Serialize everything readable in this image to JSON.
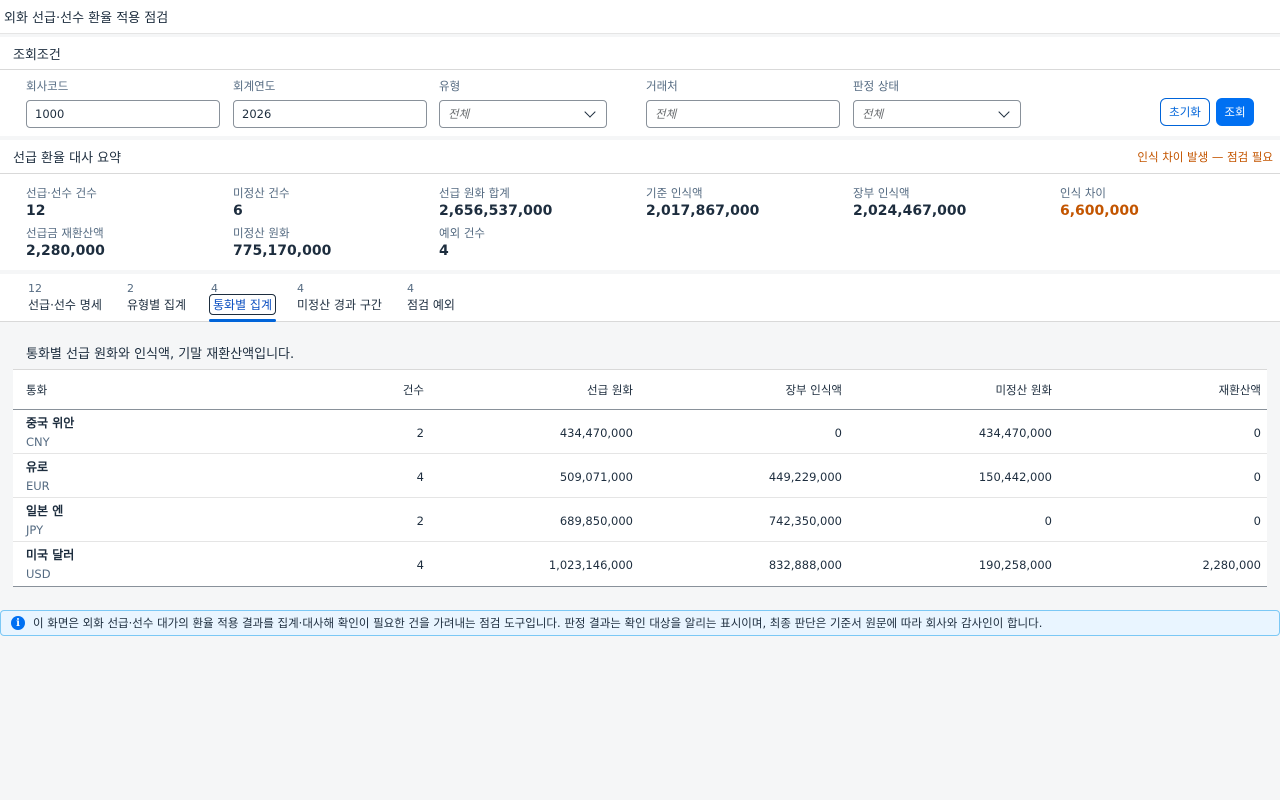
{
  "app": {
    "title": "외화 선급·선수 환율 적용 점검"
  },
  "filters": {
    "section_title": "조회조건",
    "company_code": {
      "label": "회사코드",
      "value": "1000"
    },
    "fiscal_year": {
      "label": "회계연도",
      "value": "2026"
    },
    "type": {
      "label": "유형",
      "value": "전체"
    },
    "partner": {
      "label": "거래처",
      "placeholder": "전체"
    },
    "judgment_status": {
      "label": "판정 상태",
      "value": "전체"
    },
    "reset_label": "초기화",
    "search_label": "조회"
  },
  "summary": {
    "title": "선급 환율 대사 요약",
    "warning": "인식 차이 발생 — 점검 필요",
    "kpis": [
      {
        "label": "선급·선수 건수",
        "value": "12"
      },
      {
        "label": "미정산 건수",
        "value": "6"
      },
      {
        "label": "선급 원화 합계",
        "value": "2,656,537,000"
      },
      {
        "label": "기준 인식액",
        "value": "2,017,867,000"
      },
      {
        "label": "장부 인식액",
        "value": "2,024,467,000"
      },
      {
        "label": "인식 차이",
        "value": "6,600,000"
      },
      {
        "label": "선급금 재환산액",
        "value": "2,280,000"
      },
      {
        "label": "미정산 원화",
        "value": "775,170,000"
      },
      {
        "label": "예외 건수",
        "value": "4"
      }
    ],
    "highlight_color": "#c35500"
  },
  "tabs": [
    {
      "count": "12",
      "label": "선급·선수 명세"
    },
    {
      "count": "2",
      "label": "유형별 집계"
    },
    {
      "count": "4",
      "label": "통화별 집계"
    },
    {
      "count": "4",
      "label": "미정산 경과 구간"
    },
    {
      "count": "4",
      "label": "점검 예외"
    }
  ],
  "content": {
    "description": "통화별 선급 원화와 인식액, 기말 재환산액입니다.",
    "columns": [
      "통화",
      "건수",
      "선급 원화",
      "장부 인식액",
      "미정산 원화",
      "재환산액"
    ],
    "rows": [
      {
        "name": "중국 위안",
        "code": "CNY",
        "count": "2",
        "advance_krw": "434,470,000",
        "book_recognized": "0",
        "unsettled_krw": "434,470,000",
        "revaluation": "0"
      },
      {
        "name": "유로",
        "code": "EUR",
        "count": "4",
        "advance_krw": "509,071,000",
        "book_recognized": "449,229,000",
        "unsettled_krw": "150,442,000",
        "revaluation": "0"
      },
      {
        "name": "일본 엔",
        "code": "JPY",
        "count": "2",
        "advance_krw": "689,850,000",
        "book_recognized": "742,350,000",
        "unsettled_krw": "0",
        "revaluation": "0"
      },
      {
        "name": "미국 달러",
        "code": "USD",
        "count": "4",
        "advance_krw": "1,023,146,000",
        "book_recognized": "832,888,000",
        "unsettled_krw": "190,258,000",
        "revaluation": "2,280,000"
      }
    ]
  },
  "info": {
    "icon": "info-icon",
    "text": "이 화면은 외화 선급·선수 대가의 환율 적용 결과를 집계·대사해 확인이 필요한 건을 가려내는 점검 도구입니다. 판정 결과는 확인 대상을 알리는 표시이며, 최종 판단은 기준서 원문에 따라 회사와 감사인이 합니다."
  }
}
